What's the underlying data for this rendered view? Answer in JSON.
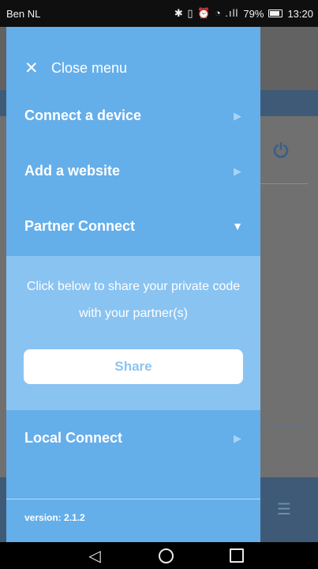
{
  "status_bar": {
    "carrier": "Ben NL",
    "icons": "✱ ▯ ⏰ ◔ .ıll",
    "battery": "79%",
    "time": "13:20"
  },
  "drawer": {
    "close_label": "Close menu",
    "items": [
      {
        "label": "Connect a device",
        "icon": "chevron-right"
      },
      {
        "label": "Add a website",
        "icon": "chevron-right"
      },
      {
        "label": "Partner Connect",
        "icon": "chevron-down"
      },
      {
        "label": "Local Connect",
        "icon": "chevron-right"
      }
    ],
    "partner_panel": {
      "text": "Click below to share your private code with your partner(s)",
      "share_label": "Share"
    },
    "version": "version: 2.1.2"
  },
  "colors": {
    "drawer": "#64aeea",
    "panel": "#89c3f2",
    "background_dim": "#6f6f6f",
    "accent_dark": "#3f5a77"
  }
}
